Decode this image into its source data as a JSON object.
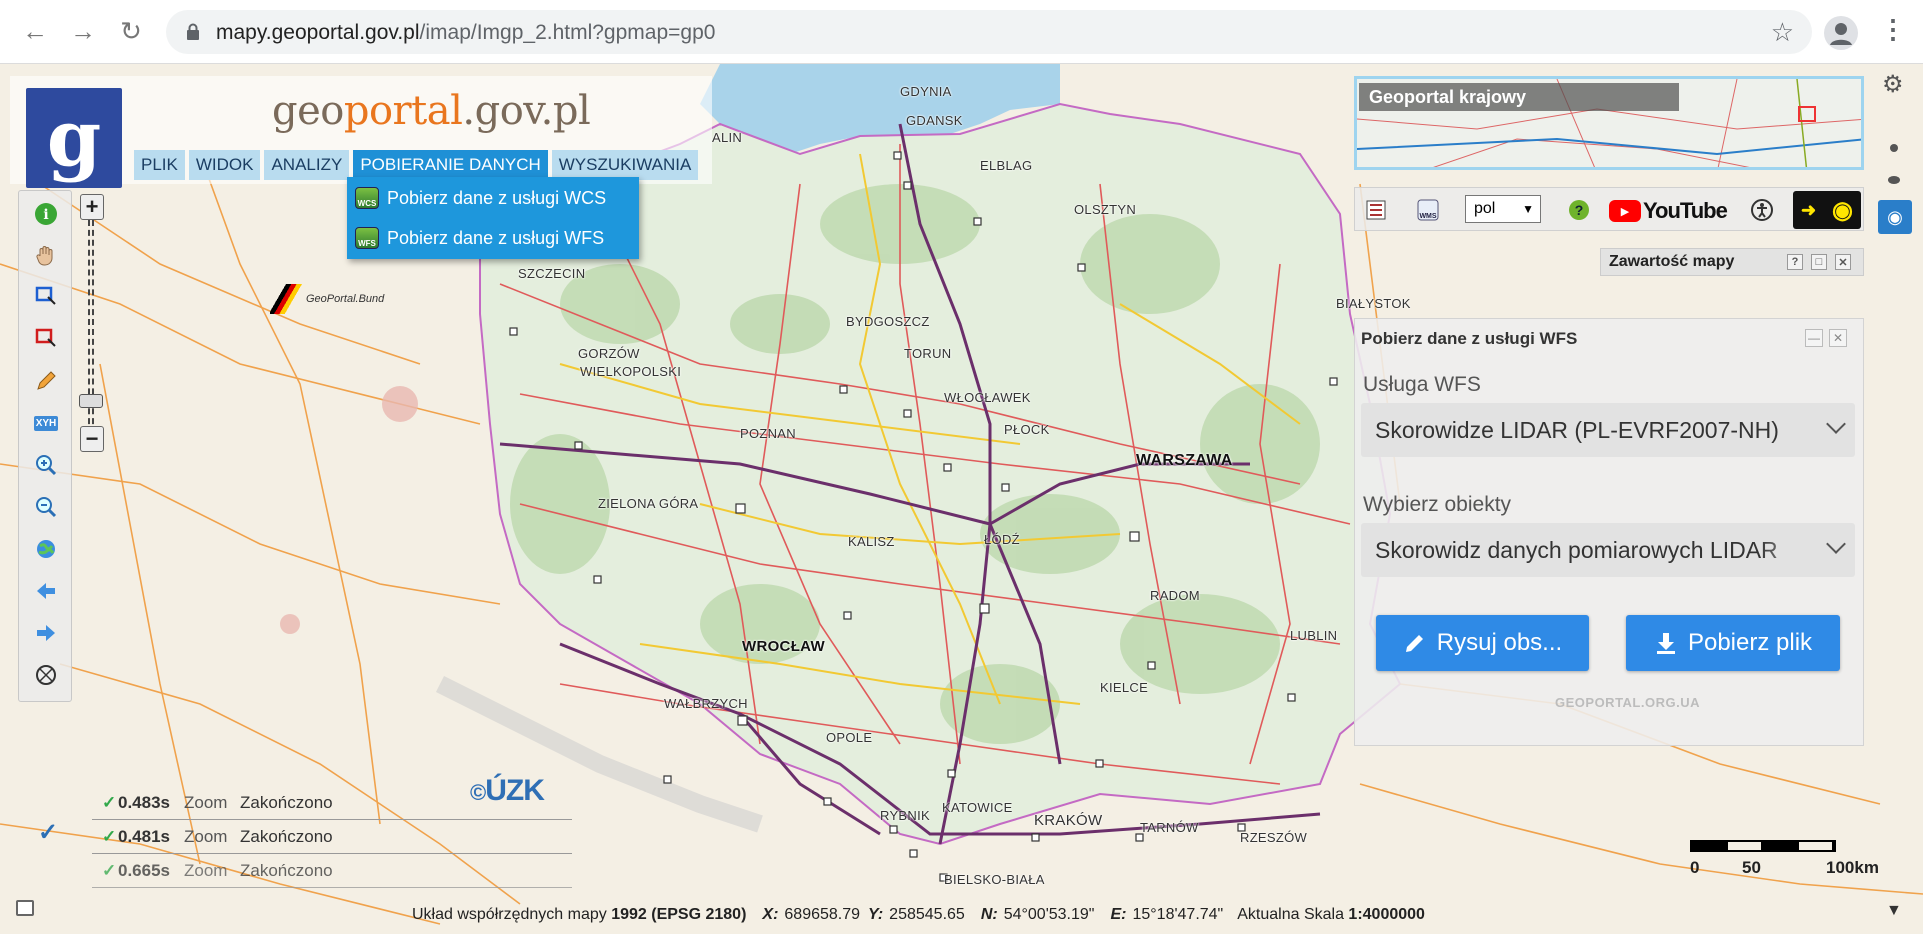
{
  "browser": {
    "url_host": "mapy.geoportal.gov.pl",
    "url_path": "/imap/Imgp_2.html?gpmap=gp0"
  },
  "header": {
    "site_name_pre": "geo",
    "site_name_hl": "portal",
    "site_name_post": ".gov.pl",
    "logo_letter": "g"
  },
  "menu": [
    {
      "label": "PLIK"
    },
    {
      "label": "WIDOK"
    },
    {
      "label": "ANALIZY"
    },
    {
      "label": "POBIERANIE DANYCH",
      "active": true
    },
    {
      "label": "WYSZUKIWANIA"
    }
  ],
  "dropdown": {
    "wcs_label": "Pobierz dane z usługi WCS",
    "wcs_icon": "WCS",
    "wfs_label": "Pobierz dane z usługi WFS",
    "wfs_icon": "WFS"
  },
  "toolbar": {
    "xyh_label": "XYH"
  },
  "cities": [
    {
      "name": "GDYNIA"
    },
    {
      "name": "GDANSK"
    },
    {
      "name": "ELBLAG"
    },
    {
      "name": "OLSZTYN"
    },
    {
      "name": "SZCZECIN"
    },
    {
      "name": "BYDGOSZCZ"
    },
    {
      "name": "TORUN"
    },
    {
      "name": "BIAŁYSTOK"
    },
    {
      "name": "GORZÓW"
    },
    {
      "name": "WIELKOPOLSKI"
    },
    {
      "name": "WŁOCŁAWEK"
    },
    {
      "name": "PŁOCK"
    },
    {
      "name": "POZNAN"
    },
    {
      "name": "WARSZAWA"
    },
    {
      "name": "ZIELONA GÓRA"
    },
    {
      "name": "KALISZ"
    },
    {
      "name": "ŁÓDŹ"
    },
    {
      "name": "RADOM"
    },
    {
      "name": "LUBLIN"
    },
    {
      "name": "WROCŁAW"
    },
    {
      "name": "KIELCE"
    },
    {
      "name": "WAŁBRZYCH"
    },
    {
      "name": "OPOLE"
    },
    {
      "name": "KATOWICE"
    },
    {
      "name": "RYBNIK"
    },
    {
      "name": "KRAKÓW"
    },
    {
      "name": "TARNÓW"
    },
    {
      "name": "RZESZÓW"
    },
    {
      "name": "BIELSKO-BIAŁA"
    },
    {
      "name": "ALIN"
    }
  ],
  "bund_label": "GeoPortal.Bund",
  "uzk_label": "ÚZK",
  "log": [
    {
      "time": "0.483s",
      "op": "Zoom",
      "status": "Zakończono"
    },
    {
      "time": "0.481s",
      "op": "Zoom",
      "status": "Zakończono"
    },
    {
      "time": "0.665s",
      "op": "Zoom",
      "status": "Zakończono"
    }
  ],
  "scalebar": {
    "l0": "0",
    "l1": "50",
    "l2": "100km"
  },
  "status": {
    "prefix": "Układ współrzędnych mapy",
    "crs": "1992 (EPSG 2180)",
    "x_label": "X:",
    "x_value": "689658.79",
    "y_label": "Y:",
    "y_value": "258545.65",
    "n_label": "N:",
    "n_value": "54°00'53.19\"",
    "e_label": "E:",
    "e_value": "15°18'47.74\"",
    "scale_label": "Aktualna Skala",
    "scale_value": "1:4000000"
  },
  "overview": {
    "title": "Geoportal krajowy"
  },
  "icon_row": {
    "lang": "pol",
    "youtube": "YouTube"
  },
  "content_tab": {
    "title": "Zawartość mapy"
  },
  "wfs_panel": {
    "title": "Pobierz dane z usługi WFS",
    "service_label": "Usługa WFS",
    "service_value": "Skorowidze LIDAR (PL-EVRF2007-NH)",
    "objects_label": "Wybierz obiekty",
    "objects_value": "Skorowidz danych pomiarowych LIDAR",
    "draw_button": "Rysuj obs...",
    "download_button": "Pobierz plik",
    "watermark": "GEOPORTAL.ORG.UA"
  },
  "colors": {
    "accent": "#1f90d6",
    "button_blue": "#2f8ae6",
    "menu_bg": "#b9dcef",
    "logo_blue": "#2e4a9e",
    "road_red": "#e05a5a",
    "road_yellow": "#f2c933",
    "road_orange": "#f09a3c",
    "motorway": "#6b2f6b"
  }
}
